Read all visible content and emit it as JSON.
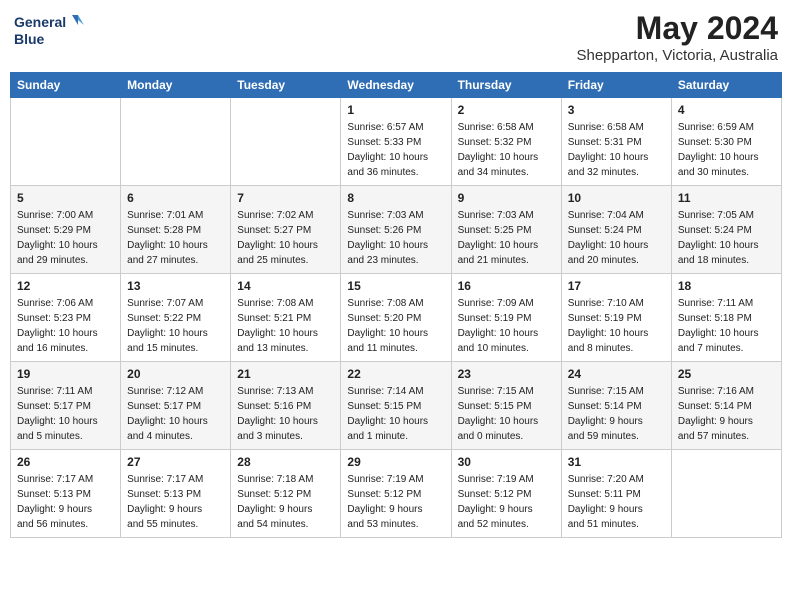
{
  "header": {
    "logo_line1": "General",
    "logo_line2": "Blue",
    "title": "May 2024",
    "subtitle": "Shepparton, Victoria, Australia"
  },
  "weekdays": [
    "Sunday",
    "Monday",
    "Tuesday",
    "Wednesday",
    "Thursday",
    "Friday",
    "Saturday"
  ],
  "weeks": [
    [
      {
        "day": "",
        "info": ""
      },
      {
        "day": "",
        "info": ""
      },
      {
        "day": "",
        "info": ""
      },
      {
        "day": "1",
        "info": "Sunrise: 6:57 AM\nSunset: 5:33 PM\nDaylight: 10 hours\nand 36 minutes."
      },
      {
        "day": "2",
        "info": "Sunrise: 6:58 AM\nSunset: 5:32 PM\nDaylight: 10 hours\nand 34 minutes."
      },
      {
        "day": "3",
        "info": "Sunrise: 6:58 AM\nSunset: 5:31 PM\nDaylight: 10 hours\nand 32 minutes."
      },
      {
        "day": "4",
        "info": "Sunrise: 6:59 AM\nSunset: 5:30 PM\nDaylight: 10 hours\nand 30 minutes."
      }
    ],
    [
      {
        "day": "5",
        "info": "Sunrise: 7:00 AM\nSunset: 5:29 PM\nDaylight: 10 hours\nand 29 minutes."
      },
      {
        "day": "6",
        "info": "Sunrise: 7:01 AM\nSunset: 5:28 PM\nDaylight: 10 hours\nand 27 minutes."
      },
      {
        "day": "7",
        "info": "Sunrise: 7:02 AM\nSunset: 5:27 PM\nDaylight: 10 hours\nand 25 minutes."
      },
      {
        "day": "8",
        "info": "Sunrise: 7:03 AM\nSunset: 5:26 PM\nDaylight: 10 hours\nand 23 minutes."
      },
      {
        "day": "9",
        "info": "Sunrise: 7:03 AM\nSunset: 5:25 PM\nDaylight: 10 hours\nand 21 minutes."
      },
      {
        "day": "10",
        "info": "Sunrise: 7:04 AM\nSunset: 5:24 PM\nDaylight: 10 hours\nand 20 minutes."
      },
      {
        "day": "11",
        "info": "Sunrise: 7:05 AM\nSunset: 5:24 PM\nDaylight: 10 hours\nand 18 minutes."
      }
    ],
    [
      {
        "day": "12",
        "info": "Sunrise: 7:06 AM\nSunset: 5:23 PM\nDaylight: 10 hours\nand 16 minutes."
      },
      {
        "day": "13",
        "info": "Sunrise: 7:07 AM\nSunset: 5:22 PM\nDaylight: 10 hours\nand 15 minutes."
      },
      {
        "day": "14",
        "info": "Sunrise: 7:08 AM\nSunset: 5:21 PM\nDaylight: 10 hours\nand 13 minutes."
      },
      {
        "day": "15",
        "info": "Sunrise: 7:08 AM\nSunset: 5:20 PM\nDaylight: 10 hours\nand 11 minutes."
      },
      {
        "day": "16",
        "info": "Sunrise: 7:09 AM\nSunset: 5:19 PM\nDaylight: 10 hours\nand 10 minutes."
      },
      {
        "day": "17",
        "info": "Sunrise: 7:10 AM\nSunset: 5:19 PM\nDaylight: 10 hours\nand 8 minutes."
      },
      {
        "day": "18",
        "info": "Sunrise: 7:11 AM\nSunset: 5:18 PM\nDaylight: 10 hours\nand 7 minutes."
      }
    ],
    [
      {
        "day": "19",
        "info": "Sunrise: 7:11 AM\nSunset: 5:17 PM\nDaylight: 10 hours\nand 5 minutes."
      },
      {
        "day": "20",
        "info": "Sunrise: 7:12 AM\nSunset: 5:17 PM\nDaylight: 10 hours\nand 4 minutes."
      },
      {
        "day": "21",
        "info": "Sunrise: 7:13 AM\nSunset: 5:16 PM\nDaylight: 10 hours\nand 3 minutes."
      },
      {
        "day": "22",
        "info": "Sunrise: 7:14 AM\nSunset: 5:15 PM\nDaylight: 10 hours\nand 1 minute."
      },
      {
        "day": "23",
        "info": "Sunrise: 7:15 AM\nSunset: 5:15 PM\nDaylight: 10 hours\nand 0 minutes."
      },
      {
        "day": "24",
        "info": "Sunrise: 7:15 AM\nSunset: 5:14 PM\nDaylight: 9 hours\nand 59 minutes."
      },
      {
        "day": "25",
        "info": "Sunrise: 7:16 AM\nSunset: 5:14 PM\nDaylight: 9 hours\nand 57 minutes."
      }
    ],
    [
      {
        "day": "26",
        "info": "Sunrise: 7:17 AM\nSunset: 5:13 PM\nDaylight: 9 hours\nand 56 minutes."
      },
      {
        "day": "27",
        "info": "Sunrise: 7:17 AM\nSunset: 5:13 PM\nDaylight: 9 hours\nand 55 minutes."
      },
      {
        "day": "28",
        "info": "Sunrise: 7:18 AM\nSunset: 5:12 PM\nDaylight: 9 hours\nand 54 minutes."
      },
      {
        "day": "29",
        "info": "Sunrise: 7:19 AM\nSunset: 5:12 PM\nDaylight: 9 hours\nand 53 minutes."
      },
      {
        "day": "30",
        "info": "Sunrise: 7:19 AM\nSunset: 5:12 PM\nDaylight: 9 hours\nand 52 minutes."
      },
      {
        "day": "31",
        "info": "Sunrise: 7:20 AM\nSunset: 5:11 PM\nDaylight: 9 hours\nand 51 minutes."
      },
      {
        "day": "",
        "info": ""
      }
    ]
  ]
}
